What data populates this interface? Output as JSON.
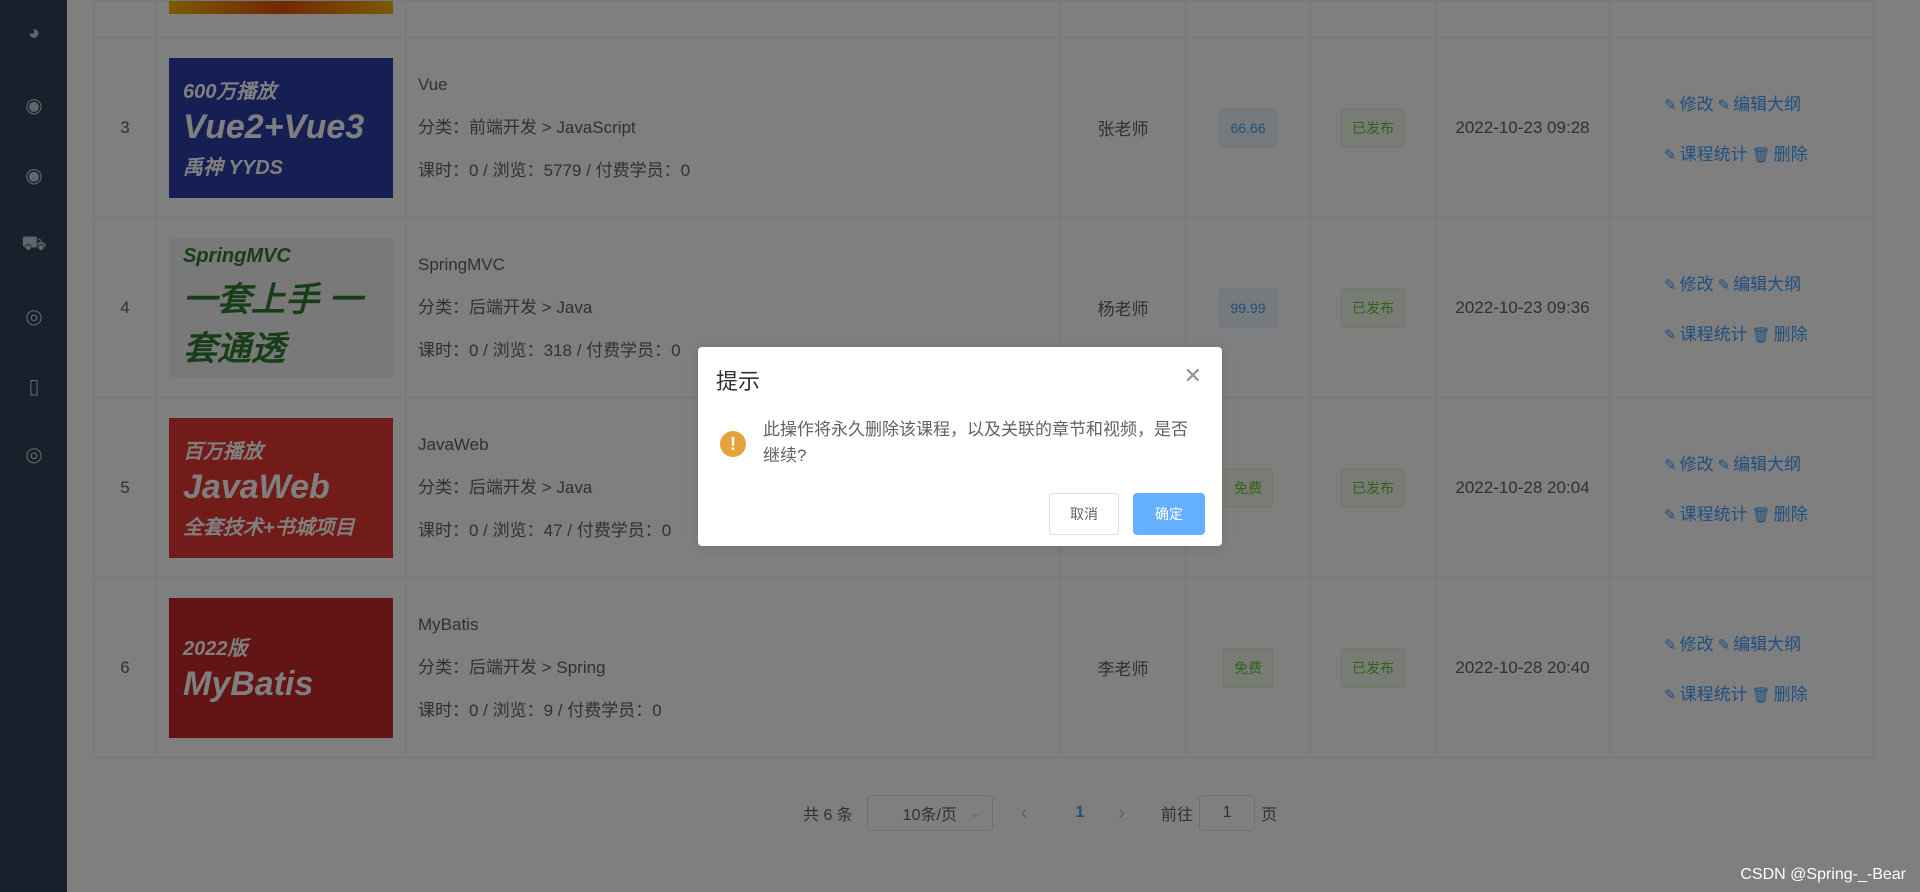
{
  "sidebar": {
    "icons": [
      "dashboard-icon",
      "course-icon",
      "lesson-icon",
      "truck-icon",
      "basketball-icon",
      "fridge-icon",
      "lifebuoy-icon"
    ]
  },
  "table": {
    "rows": [
      {
        "index": "3",
        "cover": {
          "line1": "600万播放",
          "line2": "Vue2+Vue3",
          "line3": "禹神 YYDS",
          "bg": "#2c3fa8",
          "fg": "#ffffff"
        },
        "title": "Vue",
        "category": "分类：前端开发 > JavaScript",
        "stats": "课时：0 / 浏览：5779 / 付费学员：0",
        "teacher": "张老师",
        "price": "66.66",
        "price_type": "price",
        "status": "已发布",
        "time": "2022-10-23 09:28"
      },
      {
        "index": "4",
        "cover": {
          "line1": "SpringMVC",
          "line2": "一套上手 一套通透",
          "line3": "",
          "bg": "#f2f2f2",
          "fg": "#2e7d32"
        },
        "title": "SpringMVC",
        "category": "分类：后端开发 > Java",
        "stats": "课时：0 / 浏览：318 / 付费学员：0",
        "teacher": "杨老师",
        "price": "99.99",
        "price_type": "price",
        "status": "已发布",
        "time": "2022-10-23 09:36"
      },
      {
        "index": "5",
        "cover": {
          "line1": "百万播放",
          "line2": "JavaWeb",
          "line3": "全套技术+书城项目",
          "bg": "#e53935",
          "fg": "#ffffff"
        },
        "title": "JavaWeb",
        "category": "分类：后端开发 > Java",
        "stats": "课时：0 / 浏览：47 / 付费学员：0",
        "teacher": "",
        "price": "免费",
        "price_type": "free",
        "status": "已发布",
        "time": "2022-10-28 20:04"
      },
      {
        "index": "6",
        "cover": {
          "line1": "2022版",
          "line2": "MyBatis",
          "line3": "",
          "bg": "#c62828",
          "fg": "#ffffff"
        },
        "title": "MyBatis",
        "category": "分类：后端开发 > Spring",
        "stats": "课时：0 / 浏览：9 / 付费学员：0",
        "teacher": "李老师",
        "price": "免费",
        "price_type": "free",
        "status": "已发布",
        "time": "2022-10-28 20:40"
      }
    ],
    "actions": {
      "edit": "修改",
      "outline": "编辑大纲",
      "stats": "课程统计",
      "delete": "删除"
    }
  },
  "pagination": {
    "total": "共 6 条",
    "page_size": "10条/页",
    "current": "1",
    "goto_label": "前往",
    "goto_value": "1",
    "page_suffix": "页"
  },
  "dialog": {
    "title": "提示",
    "message": "此操作将永久删除该课程，以及关联的章节和视频，是否继续?",
    "cancel": "取消",
    "confirm": "确定"
  },
  "watermark": "CSDN @Spring-_-Bear",
  "colors": {
    "primary": "#409eff",
    "warning": "#e6a23c",
    "success": "#67c23a",
    "sidebar": "#304156"
  }
}
